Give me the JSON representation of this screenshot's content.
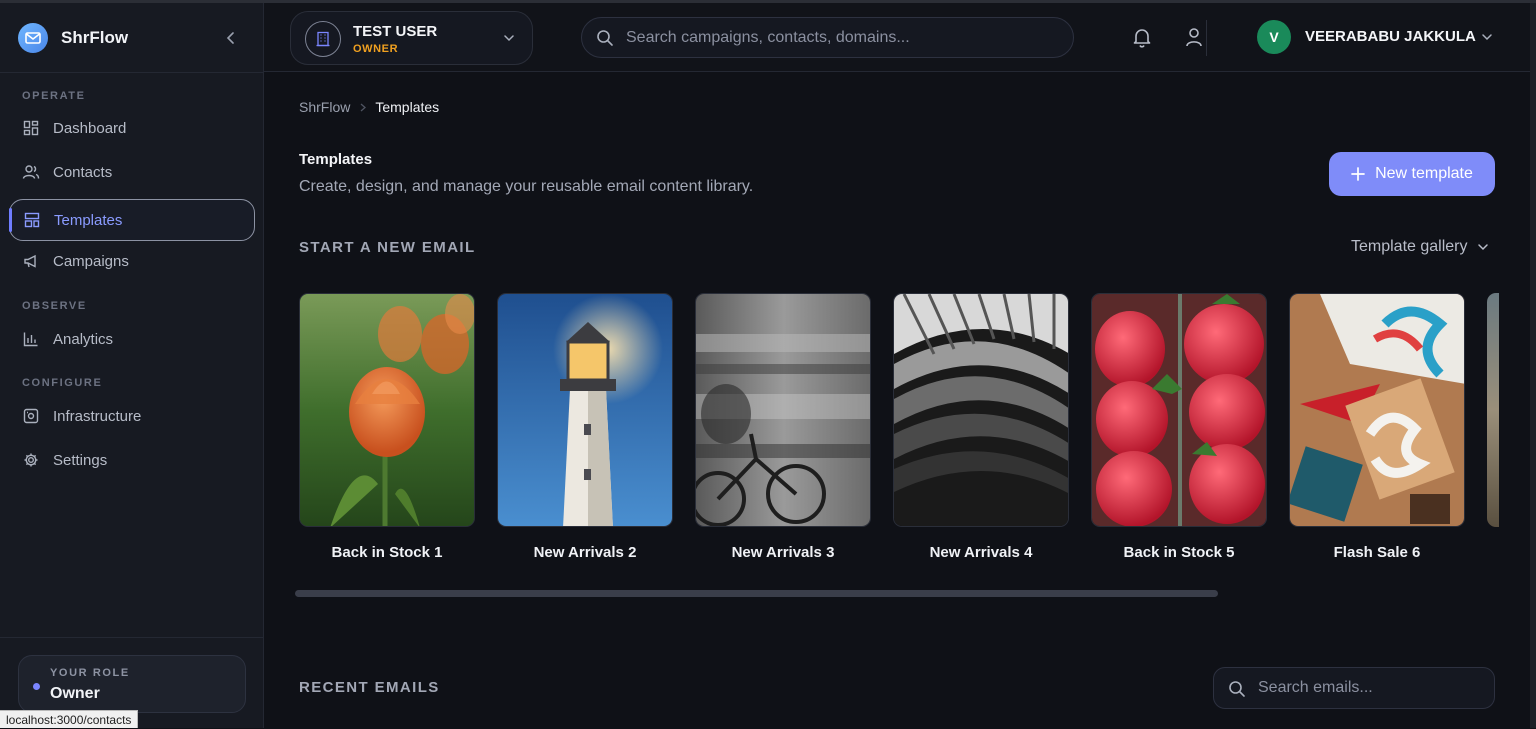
{
  "brand": {
    "name": "ShrFlow"
  },
  "sidebar": {
    "sections": [
      {
        "label": "OPERATE"
      },
      {
        "label": "OBSERVE"
      },
      {
        "label": "CONFIGURE"
      }
    ],
    "items": [
      {
        "label": "Dashboard",
        "icon": "dashboard-icon"
      },
      {
        "label": "Contacts",
        "icon": "users-icon"
      },
      {
        "label": "Templates",
        "icon": "layout-icon",
        "active": true
      },
      {
        "label": "Campaigns",
        "icon": "megaphone-icon"
      },
      {
        "label": "Analytics",
        "icon": "bar-chart-icon"
      },
      {
        "label": "Infrastructure",
        "icon": "server-icon"
      },
      {
        "label": "Settings",
        "icon": "gear-icon"
      }
    ],
    "role": {
      "label": "YOUR ROLE",
      "value": "Owner"
    },
    "status_url": "localhost:3000/contacts"
  },
  "header": {
    "org": {
      "name": "TEST USER",
      "role": "OWNER"
    },
    "search": {
      "placeholder": "Search campaigns, contacts, domains..."
    },
    "user": {
      "initial": "V",
      "name": "VEERABABU JAKKULA"
    }
  },
  "breadcrumb": {
    "root": "ShrFlow",
    "current": "Templates"
  },
  "page": {
    "title": "Templates",
    "subtitle": "Create, design, and manage your reusable email content library.",
    "new_button": "New template"
  },
  "start_section": {
    "heading": "START A NEW EMAIL",
    "gallery_link": "Template gallery",
    "templates": [
      {
        "label": "Back in Stock 1",
        "image": "tulips-photo"
      },
      {
        "label": "New Arrivals 2",
        "image": "lighthouse-photo"
      },
      {
        "label": "New Arrivals 3",
        "image": "cyclist-blur-photo"
      },
      {
        "label": "New Arrivals 4",
        "image": "architecture-photo"
      },
      {
        "label": "Back in Stock 5",
        "image": "strawberries-photo"
      },
      {
        "label": "Flash Sale 6",
        "image": "stickers-photo"
      }
    ]
  },
  "recent_section": {
    "heading": "RECENT EMAILS",
    "search_placeholder": "Search emails..."
  },
  "colors": {
    "accent": "#7f8cf9",
    "active_nav": "#8a9bff",
    "owner_badge": "#f0a020",
    "avatar": "#1a8a5a"
  }
}
